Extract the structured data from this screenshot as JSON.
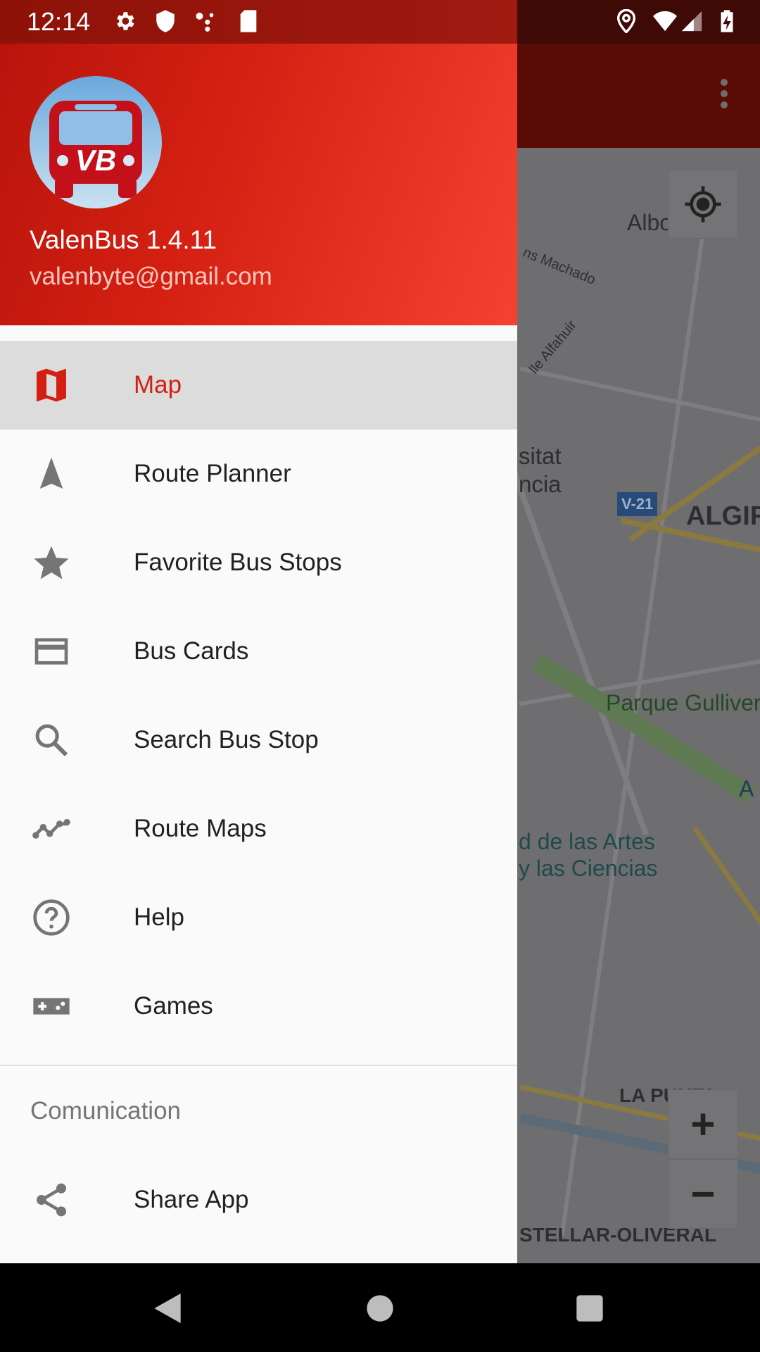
{
  "status_bar": {
    "time": "12:14",
    "left_icons": [
      "gear-icon",
      "shield-icon",
      "dots-icon",
      "sd-card-icon"
    ],
    "right_icons": [
      "location-icon",
      "wifi-icon",
      "signal-icon",
      "battery-charging-icon"
    ]
  },
  "drawer": {
    "app_title": "ValenBus 1.4.11",
    "email": "valenbyte@gmail.com",
    "logo_text": "VB",
    "accent_color": "#d32012",
    "items": [
      {
        "label": "Map",
        "icon": "map-icon",
        "selected": true
      },
      {
        "label": "Route Planner",
        "icon": "navigation-arrow-icon"
      },
      {
        "label": "Favorite Bus Stops",
        "icon": "star-icon"
      },
      {
        "label": "Bus Cards",
        "icon": "credit-card-icon"
      },
      {
        "label": "Search Bus Stop",
        "icon": "search-icon"
      },
      {
        "label": "Route Maps",
        "icon": "timeline-icon"
      },
      {
        "label": "Help",
        "icon": "help-icon"
      },
      {
        "label": "Games",
        "icon": "gamepad-icon"
      }
    ],
    "section_title": "Comunication",
    "section_items": [
      {
        "label": "Share App",
        "icon": "share-icon"
      }
    ]
  },
  "map": {
    "labels": [
      "Alboraya",
      "ns Machado",
      "lle Alfahuir",
      "sitat",
      "ncia",
      "V-21",
      "ALGIR",
      "Parque Gulliver",
      "d de las Artes",
      "y las Ciencias",
      "A",
      "LA PUNTA",
      "STELLAR-OLIVERAL"
    ],
    "zoom_in": "+",
    "zoom_out": "−"
  }
}
